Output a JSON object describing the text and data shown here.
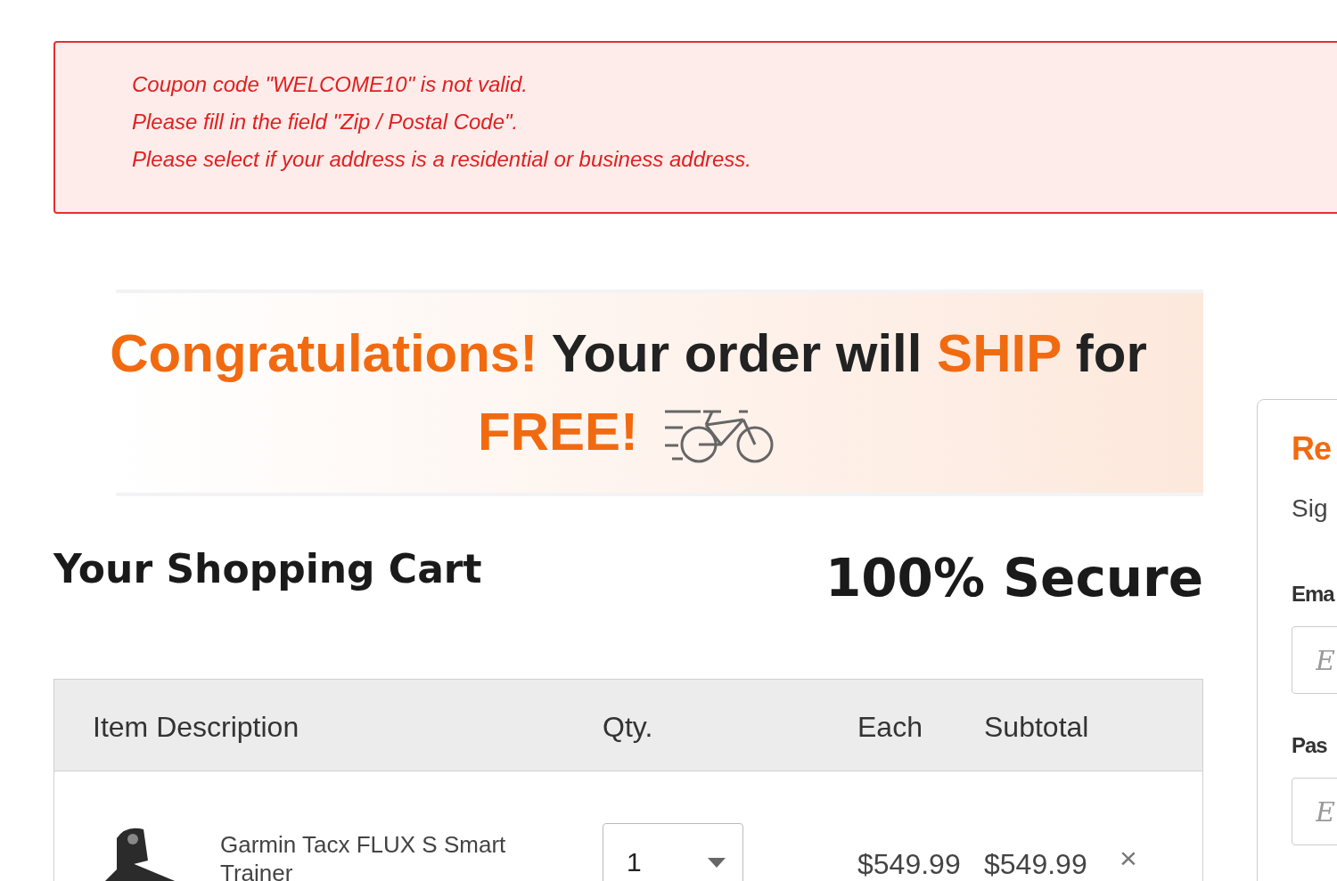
{
  "errors": [
    "Coupon code \"WELCOME10\" is not valid.",
    "Please fill in the field \"Zip / Postal Code\".",
    "Please select if your address is a residential or business address."
  ],
  "banner": {
    "segments": [
      {
        "text": "Congratulations!",
        "highlight": true
      },
      {
        "text": "Your order will",
        "highlight": false
      },
      {
        "text": "SHIP",
        "highlight": true
      },
      {
        "text": "for",
        "highlight": false
      },
      {
        "text": "FREE!",
        "highlight": true
      }
    ]
  },
  "cart_title": "Your Shopping Cart",
  "secure_label": "100% Secure",
  "table": {
    "columns": [
      "Item Description",
      "Qty.",
      "Each",
      "Subtotal"
    ],
    "rows": [
      {
        "name": "Garmin Tacx FLUX S Smart Trainer",
        "qty": "1",
        "each": "$549.99",
        "subtotal": "$549.99",
        "remove": "×"
      }
    ]
  },
  "login_panel": {
    "title": "Re",
    "subtitle": "Sig",
    "fields": [
      {
        "label": "Ema",
        "placeholder": "E"
      },
      {
        "label": "Pas",
        "placeholder": "E"
      }
    ]
  }
}
